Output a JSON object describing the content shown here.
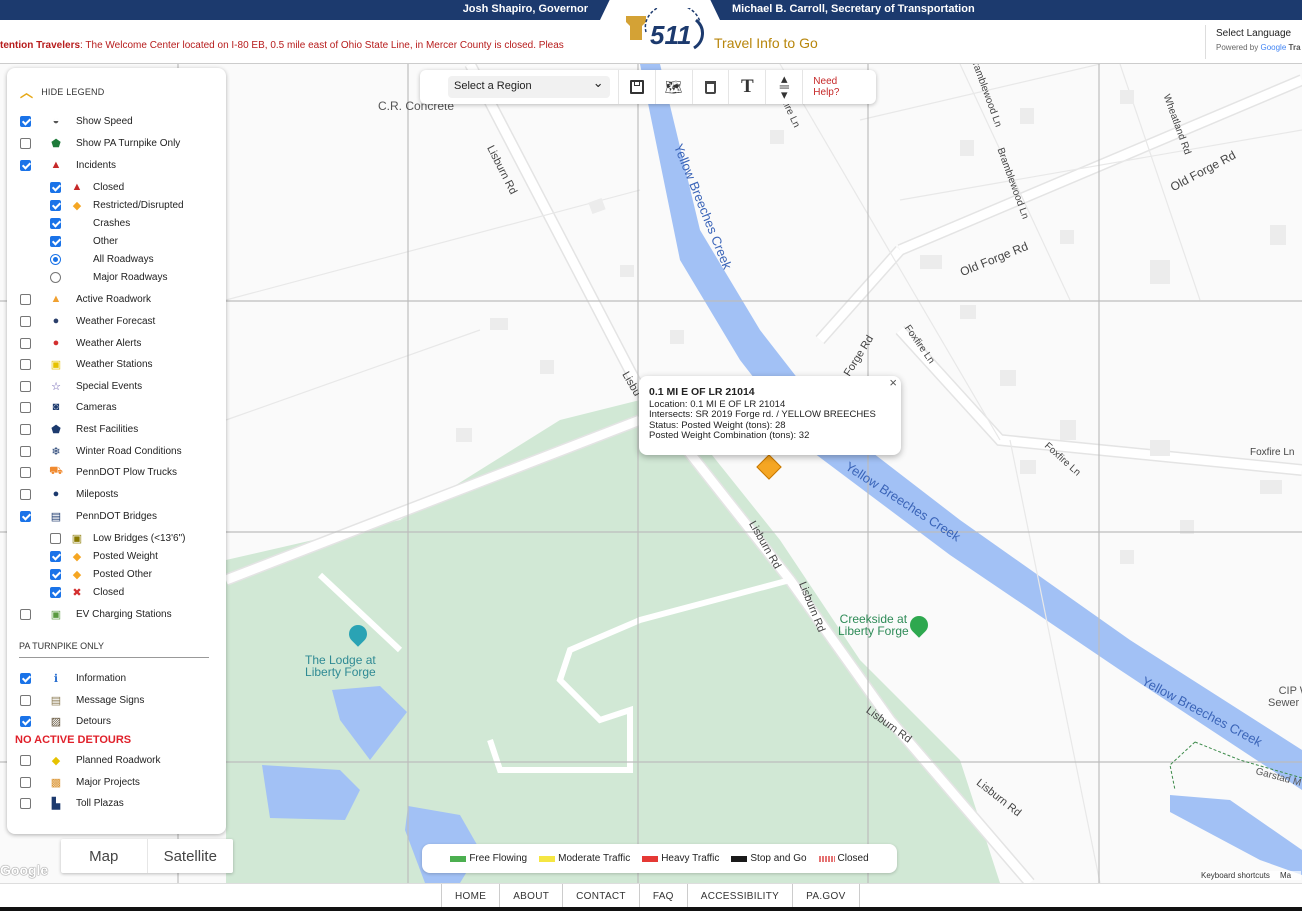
{
  "header": {
    "governor": "Josh Shapiro, Governor",
    "secretary": "Michael B. Carroll, Secretary of Transportation",
    "logo_text": "511",
    "tagline": "Travel Info to Go",
    "alert_prefix": "tention Travelers",
    "alert_text": ": The Welcome Center located on I-80 EB, 0.5 mile east of Ohio State Line, in Mercer County is closed.  Pleas",
    "language_select": "Select Language",
    "powered_by": "Powered by",
    "google": "Google",
    "translate": "Tra"
  },
  "toolbar": {
    "region_select": "Select a Region",
    "save_icon": "save-icon",
    "map_icon": "map-icon",
    "trash_icon": "trash-icon",
    "text_icon": "T",
    "resize_icon": "resize-icon",
    "help_label": "Need Help?"
  },
  "legend": {
    "hide_label": "HIDE LEGEND",
    "items": [
      {
        "label": "Show Speed",
        "checked": true,
        "icon": "speedometer-icon"
      },
      {
        "label": "Show PA Turnpike Only",
        "checked": false,
        "icon": "keystone-icon"
      },
      {
        "label": "Incidents",
        "checked": true,
        "icon": "warning-icon"
      },
      {
        "label": "Closed",
        "checked": true,
        "icon": "warning-icon",
        "sub": true
      },
      {
        "label": "Restricted/Disrupted",
        "checked": true,
        "icon": "diamond-icon",
        "sub": true
      },
      {
        "label": "Crashes",
        "checked": true,
        "sub": true
      },
      {
        "label": "Other",
        "checked": true,
        "sub": true
      },
      {
        "label": "All Roadways",
        "radio": true,
        "checked": true,
        "sub": true
      },
      {
        "label": "Major Roadways",
        "radio": true,
        "checked": false,
        "sub": true
      },
      {
        "label": "Active Roadwork",
        "checked": false,
        "icon": "cone-icon"
      },
      {
        "label": "Weather Forecast",
        "checked": false,
        "icon": "weather-forecast-icon"
      },
      {
        "label": "Weather Alerts",
        "checked": false,
        "icon": "weather-alert-icon"
      },
      {
        "label": "Weather Stations",
        "checked": false,
        "icon": "weather-station-icon"
      },
      {
        "label": "Special Events",
        "checked": false,
        "icon": "star-icon"
      },
      {
        "label": "Cameras",
        "checked": false,
        "icon": "camera-icon"
      },
      {
        "label": "Rest Facilities",
        "checked": false,
        "icon": "rest-facility-icon"
      },
      {
        "label": "Winter Road Conditions",
        "checked": false,
        "icon": "snowflake-icon"
      },
      {
        "label": "PennDOT Plow Trucks",
        "checked": false,
        "icon": "plow-truck-icon"
      },
      {
        "label": "Mileposts",
        "checked": false,
        "icon": "milepost-icon"
      },
      {
        "label": "PennDOT Bridges",
        "checked": true,
        "icon": "bridge-icon"
      },
      {
        "label": "Low Bridges (<13'6\")",
        "checked": false,
        "icon": "low-bridge-icon",
        "sub": true
      },
      {
        "label": "Posted Weight",
        "checked": true,
        "icon": "posted-weight-icon",
        "sub": true
      },
      {
        "label": "Posted Other",
        "checked": true,
        "icon": "posted-other-icon",
        "sub": true
      },
      {
        "label": "Closed",
        "checked": true,
        "icon": "bridge-closed-icon",
        "sub": true
      },
      {
        "label": "EV Charging Stations",
        "checked": false,
        "icon": "ev-charging-icon"
      }
    ],
    "turnpike_heading": "PA TURNPIKE ONLY",
    "turnpike_items": [
      {
        "label": "Information",
        "checked": true,
        "icon": "information-icon"
      },
      {
        "label": "Message Signs",
        "checked": false,
        "icon": "message-sign-icon"
      },
      {
        "label": "Detours",
        "checked": true,
        "icon": "detour-icon"
      }
    ],
    "no_detours": "NO ACTIVE DETOURS",
    "turnpike_items2": [
      {
        "label": "Planned Roadwork",
        "checked": false,
        "icon": "planned-roadwork-icon"
      },
      {
        "label": "Major Projects",
        "checked": false,
        "icon": "major-projects-icon"
      },
      {
        "label": "Toll Plazas",
        "checked": false,
        "icon": "toll-plaza-icon"
      }
    ]
  },
  "popup": {
    "title": "0.1 MI E OF LR 21014",
    "location": "Location: 0.1 MI E OF LR 21014",
    "intersects": "Intersects: SR 2019 Forge rd. / YELLOW BREECHES",
    "status": "Status: Posted Weight (tons): 28",
    "combination": "Posted Weight Combination (tons): 32",
    "close": "×"
  },
  "map_labels": {
    "cr_concrete": "C.R. Concrete",
    "lisburn1": "Lisburn Rd",
    "lisburn2": "Lisburn Rd",
    "lisburn3": "Lisburn Rd",
    "lisburn4": "Lisburn Rd",
    "lisburn5": "Lisburn Rd",
    "lisburn_partial": "Lisbu",
    "creek1": "Yellow Breeches Creek",
    "creek2": "Yellow Breeches Creek",
    "creek3": "Yellow Breeches Creek",
    "old_forge1": "Old Forge Rd",
    "old_forge2": "Old Forge Rd",
    "forge_rd": "Forge Rd",
    "bramblewood1": "Bramblewood Ln",
    "bramblewood2": "Bramblewood Ln",
    "wheatland": "Wheatland Rd",
    "foxfire1": "Foxfire Ln",
    "foxfire2": "Foxfire Ln",
    "foxfire3": "Foxfire Ln",
    "fire_ln": "fire Ln",
    "lodge": "The Lodge at\nLiberty Forge",
    "lodge1": "The Lodge at",
    "lodge2": "Liberty Forge",
    "creekside1": "Creekside at",
    "creekside2": "Liberty Forge",
    "cip1": "CIP W",
    "cip2": "Sewer C",
    "garstad": "Garstad M"
  },
  "traffic_legend": [
    {
      "label": "Free Flowing",
      "color": "#4caf50"
    },
    {
      "label": "Moderate Traffic",
      "color": "#f5e642"
    },
    {
      "label": "Heavy Traffic",
      "color": "#e53935"
    },
    {
      "label": "Stop and Go",
      "color": "#1a1a1a"
    },
    {
      "label": "Closed",
      "color": "#e57373"
    }
  ],
  "map_type": {
    "map": "Map",
    "satellite": "Satellite"
  },
  "google_logo": "Google",
  "keyboard_shortcuts": "Keyboard shortcuts",
  "map_data": "Ma",
  "footer": [
    "HOME",
    "ABOUT",
    "CONTACT",
    "FAQ",
    "ACCESSIBILITY",
    "PA.GOV"
  ]
}
